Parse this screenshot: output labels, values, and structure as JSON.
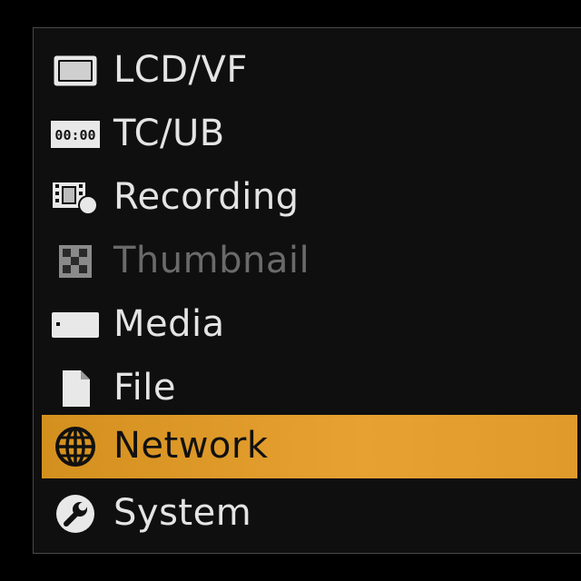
{
  "menu": {
    "items": [
      {
        "label": "LCD/VF",
        "icon": "lcd-screen-icon",
        "state": "normal"
      },
      {
        "label": "TC/UB",
        "icon": "timecode-icon",
        "icon_text": "00:00",
        "state": "normal"
      },
      {
        "label": "Recording",
        "icon": "film-record-icon",
        "state": "normal"
      },
      {
        "label": "Thumbnail",
        "icon": "thumbnail-grid-icon",
        "state": "disabled"
      },
      {
        "label": "Media",
        "icon": "media-card-icon",
        "state": "normal"
      },
      {
        "label": "File",
        "icon": "file-icon",
        "state": "normal"
      },
      {
        "label": "Network",
        "icon": "globe-icon",
        "state": "selected"
      },
      {
        "label": "System",
        "icon": "wrench-icon",
        "state": "normal"
      }
    ]
  },
  "colors": {
    "background": "#000000",
    "panel": "#0f0f0f",
    "text": "#e4e4e4",
    "disabled_text": "#6a6a6a",
    "highlight": "#e6a132"
  }
}
